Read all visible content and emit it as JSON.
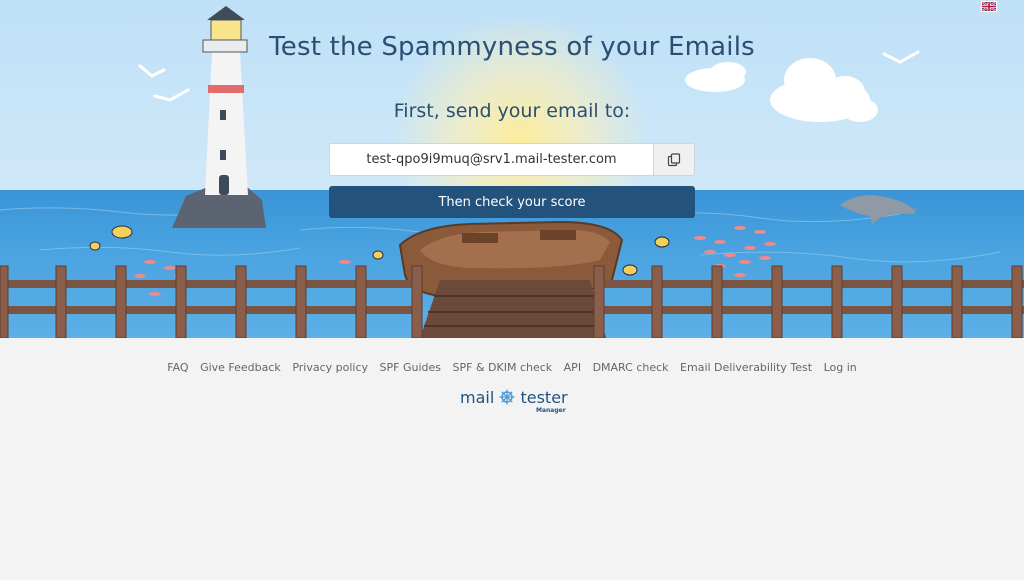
{
  "hero": {
    "title": "Test the Spammyness of your Emails",
    "subtitle": "First, send your email to:",
    "email_address": "test-qpo9i9muq@srv1.mail-tester.com",
    "check_button_label": "Then check your score"
  },
  "footer": {
    "links": [
      "FAQ",
      "Give Feedback",
      "Privacy policy",
      "SPF Guides",
      "SPF & DKIM check",
      "API",
      "DMARC check",
      "Email Deliverability Test",
      "Log in"
    ]
  },
  "logo": {
    "word1": "mail",
    "word2": "tester",
    "sub": "Manager"
  },
  "colors": {
    "primary": "#23537d",
    "title": "#2b4f73",
    "page_bg": "#f3f3f3"
  },
  "icons": {
    "copy": "copy-icon",
    "language": "uk-flag-icon"
  }
}
